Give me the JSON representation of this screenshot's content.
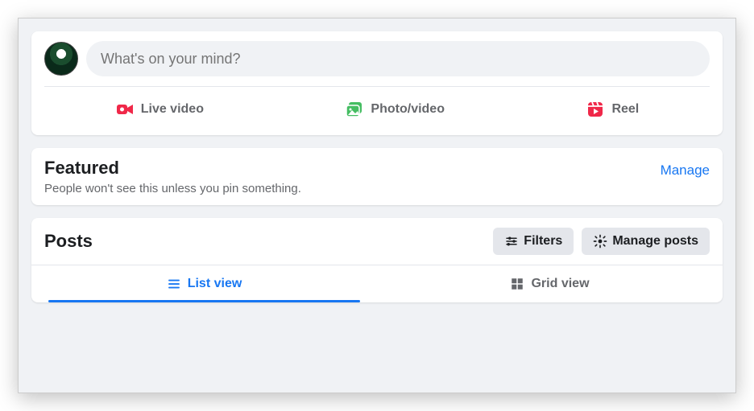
{
  "composer": {
    "placeholder": "What's on your mind?",
    "live_video": "Live video",
    "photo_video": "Photo/video",
    "reel": "Reel"
  },
  "featured": {
    "title": "Featured",
    "subtitle": "People won't see this unless you pin something.",
    "manage": "Manage"
  },
  "posts": {
    "title": "Posts",
    "filters": "Filters",
    "manage": "Manage posts",
    "list_view": "List view",
    "grid_view": "Grid view"
  }
}
